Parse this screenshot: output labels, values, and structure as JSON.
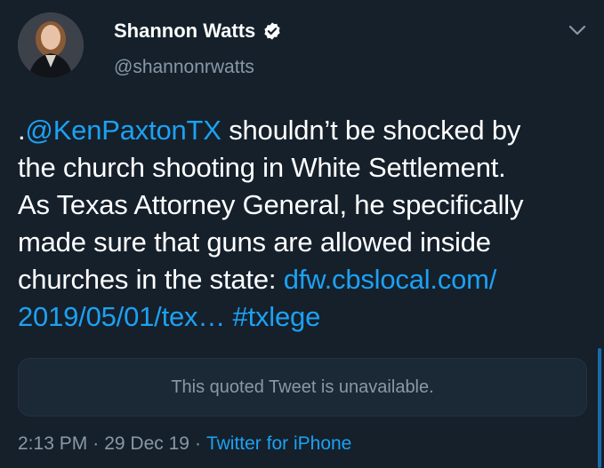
{
  "author": {
    "name": "Shannon Watts",
    "handle": "@shannonrwatts",
    "verified_icon": "verified-badge-icon"
  },
  "menu_icon": "chevron-down-icon",
  "tweet": {
    "lines": [
      [
        {
          "text": ".",
          "link": false
        },
        {
          "text": "@KenPaxtonTX",
          "link": true
        },
        {
          "text": " shouldn’t be shocked by",
          "link": false
        }
      ],
      [
        {
          "text": "the church shooting in White Settlement.",
          "link": false
        }
      ],
      [
        {
          "text": "As Texas Attorney General, he specifically",
          "link": false
        }
      ],
      [
        {
          "text": "made sure that guns are allowed inside",
          "link": false
        }
      ],
      [
        {
          "text": "churches in the state: ",
          "link": false
        },
        {
          "text": "dfw.cbslocal.com/",
          "link": true
        }
      ],
      [
        {
          "text": "2019/05/01/tex…",
          "link": true
        },
        {
          "text": " ",
          "link": false
        },
        {
          "text": "#txlege",
          "link": true
        }
      ]
    ]
  },
  "quoted_tweet": {
    "text": "This quoted Tweet is unavailable."
  },
  "meta": {
    "time": "2:13 PM",
    "separator": "·",
    "date": "29 Dec 19",
    "source": "Twitter for iPhone"
  },
  "colors": {
    "background": "#15202b",
    "link": "#1da1f2",
    "secondary_text": "#8899a6"
  }
}
